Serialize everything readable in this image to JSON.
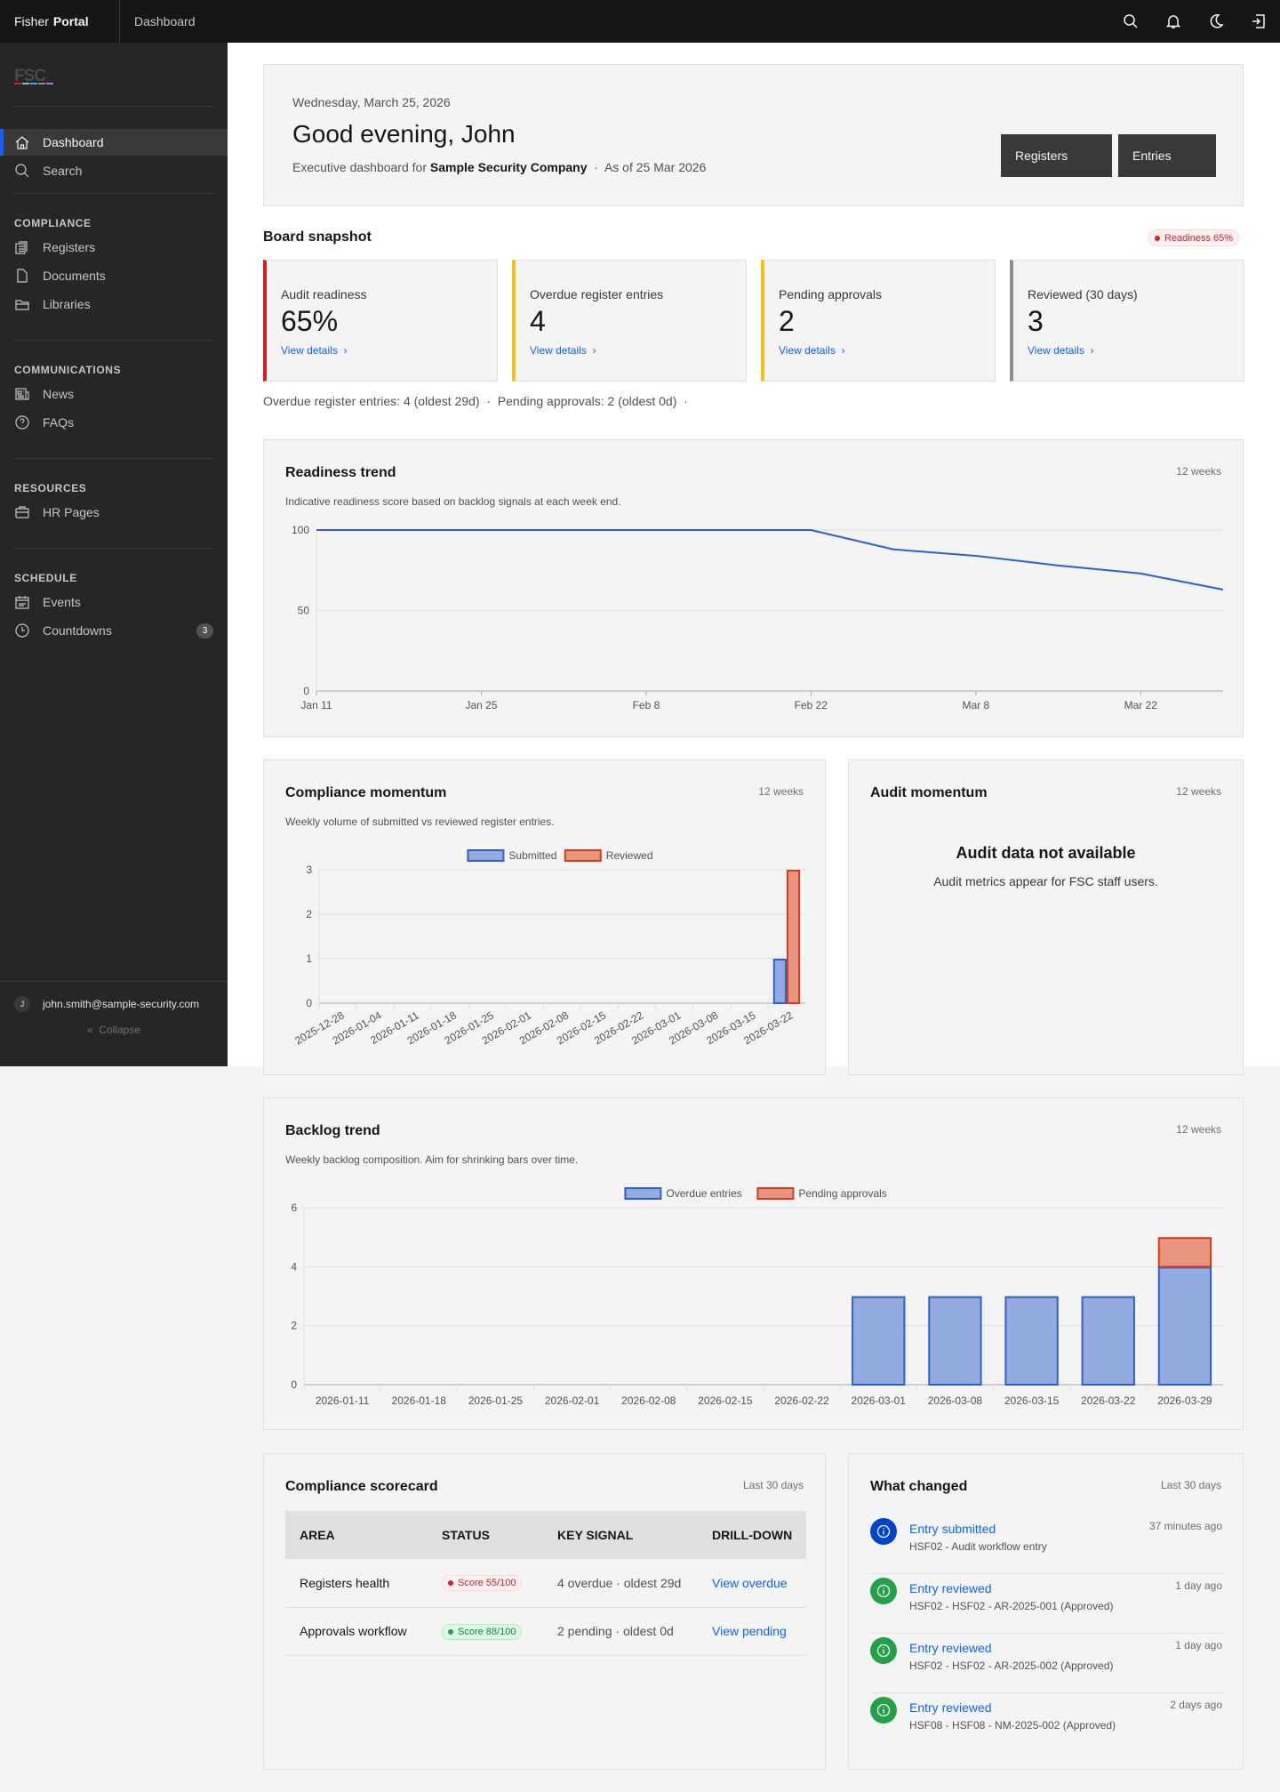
{
  "topbar": {
    "brand_first": "Fisher",
    "brand_second": "Portal",
    "breadcrumb": "Dashboard",
    "icons": [
      "search-icon",
      "bell-icon",
      "moon-icon",
      "logout-icon"
    ]
  },
  "sidebar": {
    "logo": "FSC",
    "items_top": [
      {
        "label": "Dashboard",
        "icon": "home-icon",
        "active": true
      },
      {
        "label": "Search",
        "icon": "search-icon"
      }
    ],
    "sections": [
      {
        "title": "COMPLIANCE",
        "items": [
          {
            "label": "Registers",
            "icon": "registers-icon"
          },
          {
            "label": "Documents",
            "icon": "document-icon"
          },
          {
            "label": "Libraries",
            "icon": "folder-icon"
          }
        ]
      },
      {
        "title": "COMMUNICATIONS",
        "items": [
          {
            "label": "News",
            "icon": "news-icon"
          },
          {
            "label": "FAQs",
            "icon": "help-icon"
          }
        ]
      },
      {
        "title": "RESOURCES",
        "items": [
          {
            "label": "HR Pages",
            "icon": "briefcase-icon"
          }
        ]
      },
      {
        "title": "SCHEDULE",
        "items": [
          {
            "label": "Events",
            "icon": "calendar-icon"
          },
          {
            "label": "Countdowns",
            "icon": "clock-icon",
            "badge": "3"
          }
        ]
      }
    ],
    "user_initial": "J",
    "user_email": "john.smith@sample-security.com",
    "collapse_label": "Collapse"
  },
  "hero": {
    "date": "Wednesday, March 25, 2026",
    "greeting": "Good evening, John",
    "sub_prefix": "Executive dashboard for",
    "company": "Sample Security Company",
    "as_of": "As of 25 Mar 2026",
    "buttons": [
      "Registers",
      "Entries"
    ]
  },
  "snapshot": {
    "title": "Board snapshot",
    "badge": "Readiness 65%",
    "kpis": [
      {
        "label": "Audit readiness",
        "value": "65%",
        "link": "View details",
        "color": "#da1e28"
      },
      {
        "label": "Overdue register entries",
        "value": "4",
        "link": "View details",
        "color": "#f1c21b"
      },
      {
        "label": "Pending approvals",
        "value": "2",
        "link": "View details",
        "color": "#f1c21b"
      },
      {
        "label": "Reviewed (30 days)",
        "value": "3",
        "link": "View details",
        "color": "#8d8d8d"
      }
    ],
    "summary": "Overdue register entries: 4 (oldest 29d)  ·  Pending approvals: 2 (oldest 0d)  ·"
  },
  "colors": {
    "accent": "#0f62fe",
    "line": "#2e5fd0",
    "blue_fill": "#93acdf",
    "blue_stroke": "#2e5fd0",
    "red_fill": "#e8957f",
    "red_stroke": "#da3a17"
  },
  "chart_data": [
    {
      "id": "readiness",
      "type": "line",
      "title": "Readiness trend",
      "meta": "12 weeks",
      "subtitle": "Indicative readiness score based on backlog signals at each week end.",
      "x": [
        "2026-01-11",
        "2026-01-18",
        "2026-01-25",
        "2026-02-01",
        "2026-02-08",
        "2026-02-15",
        "2026-02-22",
        "2026-03-01",
        "2026-03-08",
        "2026-03-15",
        "2026-03-22",
        "2026-03-29"
      ],
      "values": [
        100,
        100,
        100,
        100,
        100,
        100,
        100,
        88,
        84,
        78,
        73,
        63
      ],
      "xticks": [
        "Jan 11",
        "Jan 25",
        "Feb 8",
        "Feb 22",
        "Mar 8",
        "Mar 22"
      ],
      "yticks": [
        0,
        50,
        100
      ],
      "ylim": [
        0,
        100
      ],
      "grid": true
    },
    {
      "id": "momentum",
      "type": "bar",
      "title": "Compliance momentum",
      "meta": "12 weeks",
      "subtitle": "Weekly volume of submitted vs reviewed register entries.",
      "legend": "top",
      "categories": [
        "2025-12-28",
        "2026-01-04",
        "2026-01-11",
        "2026-01-18",
        "2026-01-25",
        "2026-02-01",
        "2026-02-08",
        "2026-02-15",
        "2026-02-22",
        "2026-03-01",
        "2026-03-08",
        "2026-03-15",
        "2026-03-22"
      ],
      "series": [
        {
          "name": "Submitted",
          "values": [
            0,
            0,
            0,
            0,
            0,
            0,
            0,
            0,
            0,
            0,
            0,
            0,
            1
          ]
        },
        {
          "name": "Reviewed",
          "values": [
            0,
            0,
            0,
            0,
            0,
            0,
            0,
            0,
            0,
            0,
            0,
            0,
            3
          ]
        }
      ],
      "yticks": [
        0,
        1,
        2,
        3
      ],
      "ylim": [
        0,
        3
      ],
      "grid": true
    },
    {
      "id": "backlog",
      "type": "bar",
      "stacked": true,
      "title": "Backlog trend",
      "meta": "12 weeks",
      "subtitle": "Weekly backlog composition. Aim for shrinking bars over time.",
      "legend": "top",
      "categories": [
        "2026-01-11",
        "2026-01-18",
        "2026-01-25",
        "2026-02-01",
        "2026-02-08",
        "2026-02-15",
        "2026-02-22",
        "2026-03-01",
        "2026-03-08",
        "2026-03-15",
        "2026-03-22",
        "2026-03-29"
      ],
      "series": [
        {
          "name": "Overdue entries",
          "values": [
            0,
            0,
            0,
            0,
            0,
            0,
            0,
            3,
            3,
            3,
            3,
            4
          ]
        },
        {
          "name": "Pending approvals",
          "values": [
            0,
            0,
            0,
            0,
            0,
            0,
            0,
            0,
            0,
            0,
            0,
            1
          ]
        }
      ],
      "yticks": [
        0,
        2,
        4,
        6
      ],
      "ylim": [
        0,
        6
      ],
      "grid": true
    }
  ],
  "audit": {
    "title": "Audit momentum",
    "meta": "12 weeks",
    "heading": "Audit data not available",
    "text": "Audit metrics appear for FSC staff users."
  },
  "scorecard": {
    "title": "Compliance scorecard",
    "meta": "Last 30 days",
    "headers": [
      "AREA",
      "STATUS",
      "KEY SIGNAL",
      "DRILL-DOWN"
    ],
    "rows": [
      {
        "area": "Registers health",
        "status": "Score 55/100",
        "tone": "red",
        "signal": "4 overdue · oldest 29d",
        "link": "View overdue"
      },
      {
        "area": "Approvals workflow",
        "status": "Score 88/100",
        "tone": "green",
        "signal": "2 pending · oldest 0d",
        "link": "View pending"
      }
    ]
  },
  "changes": {
    "title": "What changed",
    "meta": "Last 30 days",
    "items": [
      {
        "title": "Entry submitted",
        "sub": "HSF02 - Audit workflow entry",
        "time": "37 minutes ago",
        "color": "#0043ce"
      },
      {
        "title": "Entry reviewed",
        "sub": "HSF02 - HSF02 - AR-2025-001 (Approved)",
        "time": "1 day ago",
        "color": "#24a148"
      },
      {
        "title": "Entry reviewed",
        "sub": "HSF02 - HSF02 - AR-2025-002 (Approved)",
        "time": "1 day ago",
        "color": "#24a148"
      },
      {
        "title": "Entry reviewed",
        "sub": "HSF08 - HSF08 - NM-2025-002 (Approved)",
        "time": "2 days ago",
        "color": "#24a148"
      }
    ]
  }
}
